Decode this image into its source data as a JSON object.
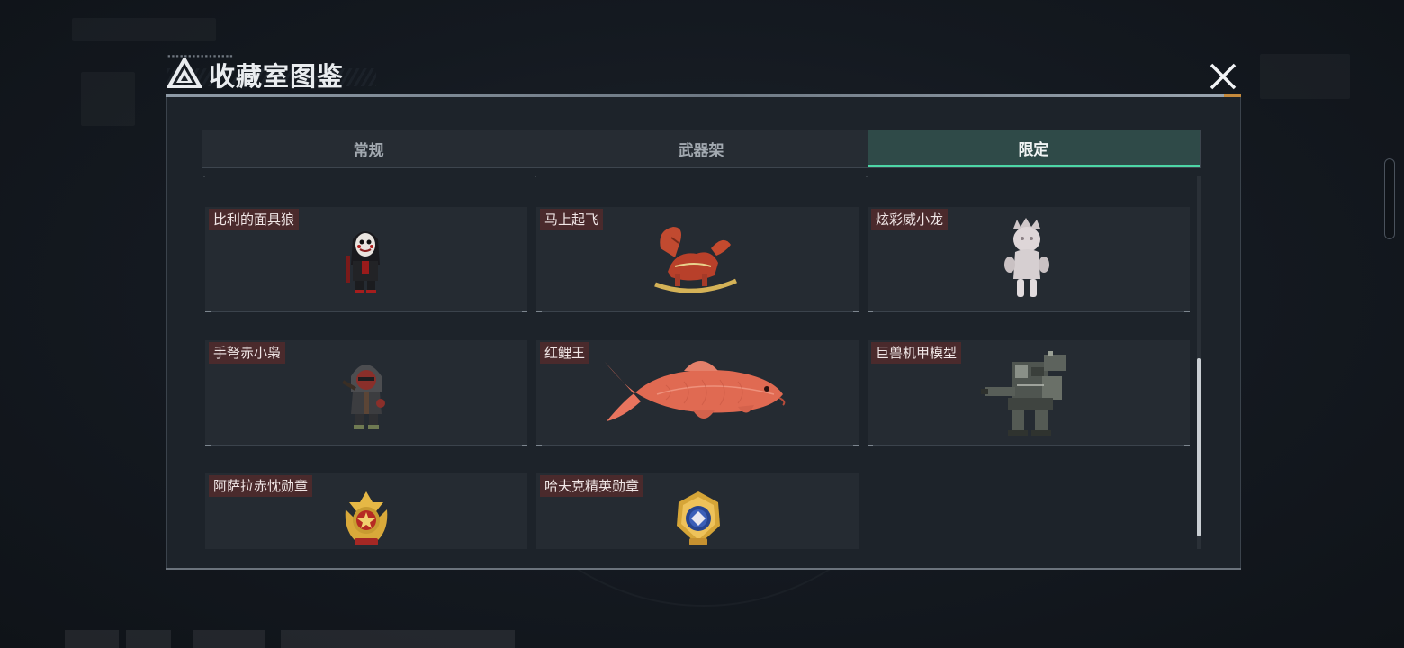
{
  "dialog": {
    "title": "收藏室图鉴",
    "close_icon": "close-icon",
    "title_logo_icon": "triangle-logo-icon"
  },
  "tabs": [
    {
      "label": "常规",
      "active": false
    },
    {
      "label": "武器架",
      "active": false
    },
    {
      "label": "限定",
      "active": true
    }
  ],
  "items": [
    {
      "name": "比利的面具狼",
      "icon": "masked-wolf-figure-icon"
    },
    {
      "name": "马上起飞",
      "icon": "rocking-horse-icon"
    },
    {
      "name": "炫彩威小龙",
      "icon": "dragon-figure-icon"
    },
    {
      "name": "手弩赤小枭",
      "icon": "hooded-figure-icon"
    },
    {
      "name": "红鲤王",
      "icon": "red-carp-icon"
    },
    {
      "name": "巨兽机甲模型",
      "icon": "mech-model-icon"
    },
    {
      "name": "阿萨拉赤忱勋章",
      "icon": "gold-medal-red-icon"
    },
    {
      "name": "哈夫克精英勋章",
      "icon": "gold-medal-blue-icon"
    }
  ],
  "colors": {
    "accent": "#4dd6a6",
    "label_bg": "#4a2a2c",
    "panel_bg": "#1d232a"
  }
}
